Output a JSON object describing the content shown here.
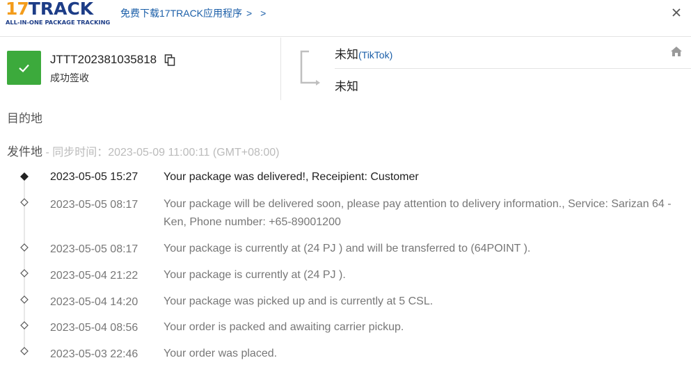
{
  "header": {
    "logo_main_prefix": "17",
    "logo_main_suffix": "TRACK",
    "logo_sub": "ALL-IN-ONE PACKAGE TRACKING",
    "app_link": "免费下载17TRACK应用程序",
    "app_link_chevrons": "> >",
    "close_icon": "close-icon"
  },
  "summary": {
    "tracking_number": "JTTT202381035818",
    "status": "成功签收",
    "status_color": "#3caa3c",
    "origin_country": "未知",
    "carrier": "(TikTok)",
    "destination_country": "未知"
  },
  "sections": {
    "destination_label": "目的地",
    "origin_label": "发件地",
    "sync_text": " - 同步时间：2023-05-09 11:00:11 (GMT+08:00)"
  },
  "events": [
    {
      "time": "2023-05-05 15:27",
      "desc": "Your package was delivered!, Receipient: Customer"
    },
    {
      "time": "2023-05-05 08:17",
      "desc": "Your package will be delivered soon, please pay attention to delivery information., Service: Sarizan 64 - Ken, Phone number: +65-89001200"
    },
    {
      "time": "2023-05-05 08:17",
      "desc": "Your package is currently at (24 PJ ) and will be transferred to (64POINT )."
    },
    {
      "time": "2023-05-04 21:22",
      "desc": "Your package is currently at (24 PJ )."
    },
    {
      "time": "2023-05-04 14:20",
      "desc": "Your package was picked up and is currently at 5 CSL."
    },
    {
      "time": "2023-05-04 08:56",
      "desc": "Your order is packed and awaiting carrier pickup."
    },
    {
      "time": "2023-05-03 22:46",
      "desc": "Your order was placed."
    }
  ]
}
